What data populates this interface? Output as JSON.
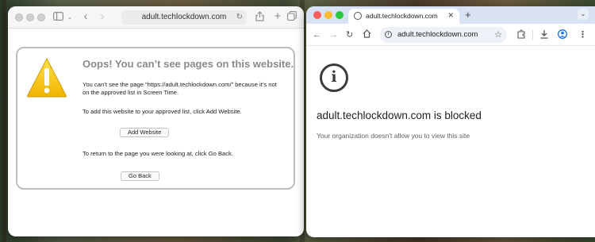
{
  "safari": {
    "url": "adult.techlockdown.com",
    "icons": [
      "sidebar-icon",
      "chevron-down-icon",
      "back-icon",
      "forward-icon",
      "reload-icon",
      "share-icon",
      "new-tab-icon",
      "tabs-overview-icon"
    ],
    "screen_time": {
      "title": "Oops! You can’t see pages on this website.",
      "message": "You can’t see the page “https://adult.techlockdown.com/” because it’s not on the approved list in Screen Time.",
      "add_instruction": "To add this website to your approved list, click Add Website.",
      "add_button": "Add Website",
      "back_instruction": "To return to the page you were looking at, click Go Back.",
      "back_button": "Go Back"
    }
  },
  "chrome": {
    "tab_title": "adult.techlockdown.com",
    "omnibox_url": "adult.techlockdown.com",
    "icons": [
      "globe-icon",
      "close-icon",
      "new-tab-icon",
      "tab-search-icon",
      "back-icon",
      "forward-icon",
      "reload-icon",
      "home-icon",
      "info-icon",
      "star-icon",
      "extensions-icon",
      "download-icon",
      "profile-icon",
      "menu-icon"
    ],
    "blocked_title": "adult.techlockdown.com is blocked",
    "blocked_message": "Your organization doesn't allow you to view this site"
  },
  "colors": {
    "chrome_tabstrip": "#d8e2f3",
    "warning_yellow": "#f5c400",
    "traffic_red": "#ff5f57",
    "traffic_yellow": "#febc2e",
    "traffic_green": "#28c840"
  }
}
